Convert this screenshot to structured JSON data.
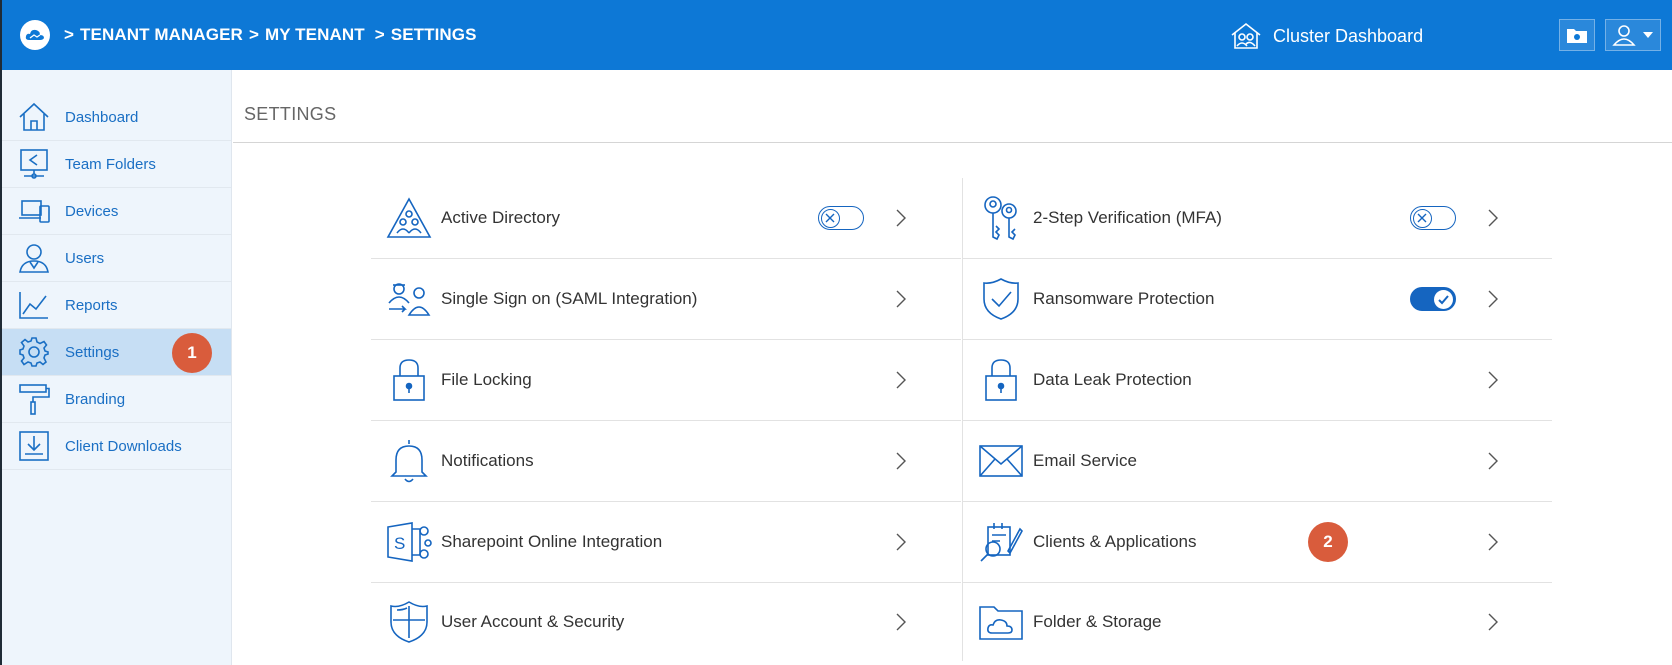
{
  "header": {
    "breadcrumb": [
      ">",
      "TENANT MANAGER",
      ">",
      "MY TENANT",
      ">",
      "SETTINGS"
    ],
    "cluster_dashboard_label": "Cluster Dashboard"
  },
  "sidebar": {
    "items": [
      {
        "label": "Dashboard",
        "icon": "home-icon"
      },
      {
        "label": "Team Folders",
        "icon": "team-folders-icon"
      },
      {
        "label": "Devices",
        "icon": "devices-icon"
      },
      {
        "label": "Users",
        "icon": "user-icon"
      },
      {
        "label": "Reports",
        "icon": "chart-icon"
      },
      {
        "label": "Settings",
        "icon": "gear-icon",
        "active": true,
        "badge": "1"
      },
      {
        "label": "Branding",
        "icon": "paint-roller-icon"
      },
      {
        "label": "Client Downloads",
        "icon": "download-icon"
      }
    ]
  },
  "main": {
    "title": "SETTINGS",
    "left_items": [
      {
        "label": "Active Directory",
        "icon": "active-directory-icon",
        "toggle": "off"
      },
      {
        "label": "Single Sign on (SAML Integration)",
        "icon": "sso-icon"
      },
      {
        "label": "File Locking",
        "icon": "lock-icon"
      },
      {
        "label": "Notifications",
        "icon": "bell-icon"
      },
      {
        "label": "Sharepoint Online Integration",
        "icon": "sharepoint-icon"
      },
      {
        "label": "User Account & Security",
        "icon": "shield-icon"
      }
    ],
    "right_items": [
      {
        "label": "2-Step Verification (MFA)",
        "icon": "keys-icon",
        "toggle": "off"
      },
      {
        "label": "Ransomware Protection",
        "icon": "shield-check-icon",
        "toggle": "on"
      },
      {
        "label": "Data Leak Protection",
        "icon": "lock-icon"
      },
      {
        "label": "Email Service",
        "icon": "envelope-icon"
      },
      {
        "label": "Clients & Applications",
        "icon": "clients-apps-icon",
        "badge": "2"
      },
      {
        "label": "Folder & Storage",
        "icon": "folder-cloud-icon"
      }
    ]
  },
  "colors": {
    "header_blue": "#0d78d6",
    "accent_blue": "#1565c0",
    "badge_orange": "#d95c3c",
    "sidebar_bg": "#eef5fc",
    "sidebar_active": "#c6def4"
  }
}
